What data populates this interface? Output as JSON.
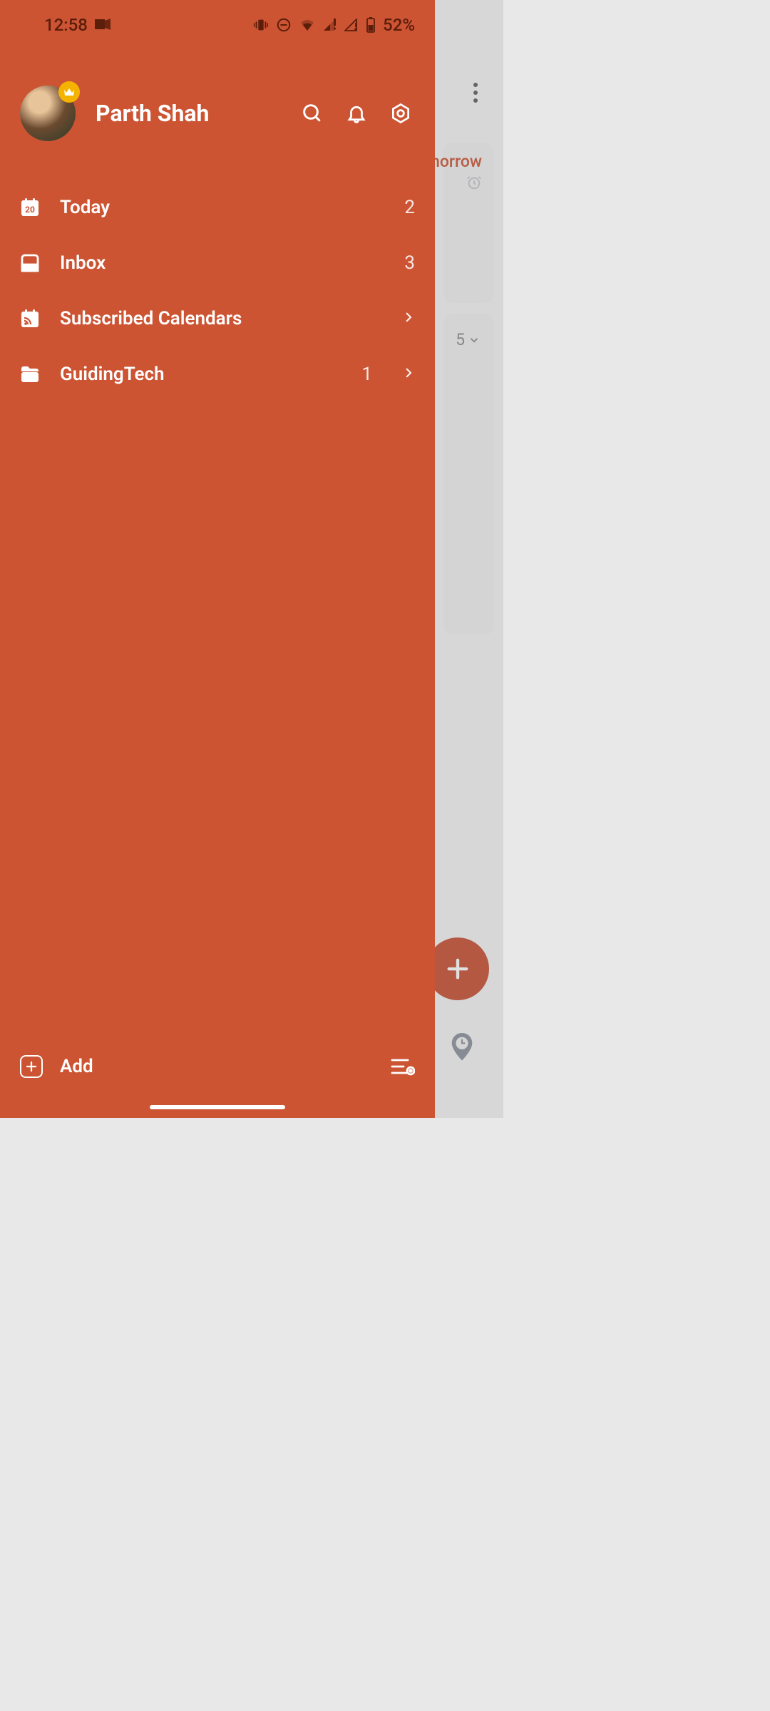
{
  "status": {
    "time": "12:58",
    "battery": "52%"
  },
  "profile": {
    "name": "Parth Shah"
  },
  "menu": {
    "today": {
      "label": "Today",
      "count": "2",
      "day": "20"
    },
    "inbox": {
      "label": "Inbox",
      "count": "3"
    },
    "calendars": {
      "label": "Subscribed Calendars"
    },
    "folder": {
      "label": "GuidingTech",
      "count": "1"
    }
  },
  "footer": {
    "add_label": "Add"
  },
  "bg": {
    "tomorrow": "morrow",
    "count5": "5"
  }
}
